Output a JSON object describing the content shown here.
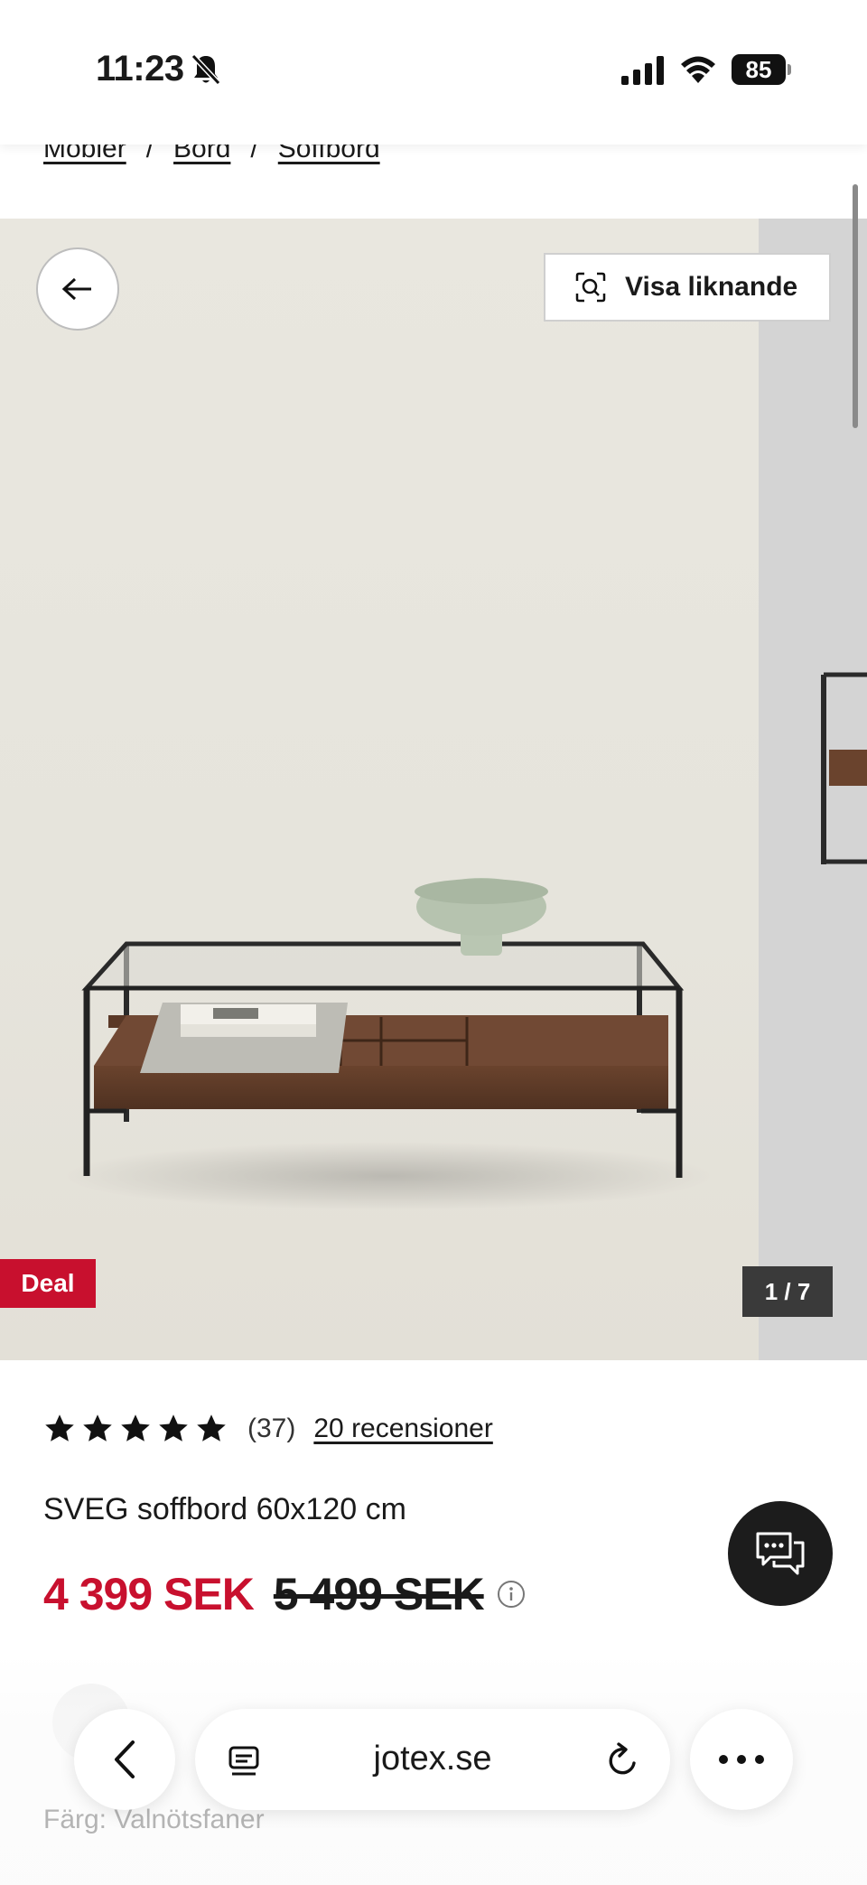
{
  "status_bar": {
    "time": "11:23",
    "battery": "85"
  },
  "breadcrumb": {
    "items": [
      "Möbler",
      "Bord",
      "Soffbord"
    ],
    "separator": "/"
  },
  "gallery": {
    "visa_label": "Visa liknande",
    "deal_label": "Deal",
    "counter": "1 / 7"
  },
  "product": {
    "rating_stars": 5,
    "rating_count": "(37)",
    "reviews_link": "20 recensioner",
    "title": "SVEG soffbord 60x120 cm",
    "price_now": "4 399 SEK",
    "price_old": "5 499 SEK",
    "color_label": "Färg: Valnötsfaner"
  },
  "browser": {
    "url": "jotex.se"
  },
  "colors": {
    "accent": "#c8102e",
    "dark": "#1c1c1c"
  }
}
